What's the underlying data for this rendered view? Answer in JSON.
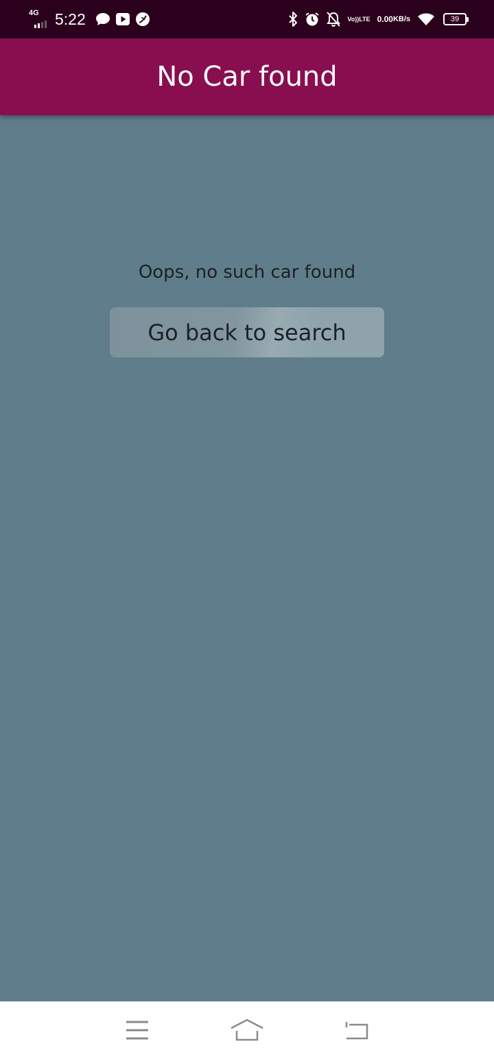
{
  "status_bar": {
    "network": "4G",
    "time": "5:22",
    "volte_top": "Vo))",
    "volte_bottom": "LTE",
    "speed_value": "0.00",
    "speed_unit": "KB/s",
    "battery": "39",
    "icons": [
      "chat-bubble-icon",
      "youtube-icon",
      "leaf-icon",
      "bluetooth-icon",
      "alarm-icon",
      "bell-off-icon",
      "wifi-icon",
      "battery-icon"
    ]
  },
  "app_bar": {
    "title": "No Car found",
    "color": "#880e4f"
  },
  "main": {
    "message": "Oops, no such car found",
    "button_label": "Go back to search",
    "background": "#607d8b"
  },
  "nav_bar": {
    "icons": [
      "menu-icon",
      "home-icon",
      "back-icon"
    ]
  }
}
